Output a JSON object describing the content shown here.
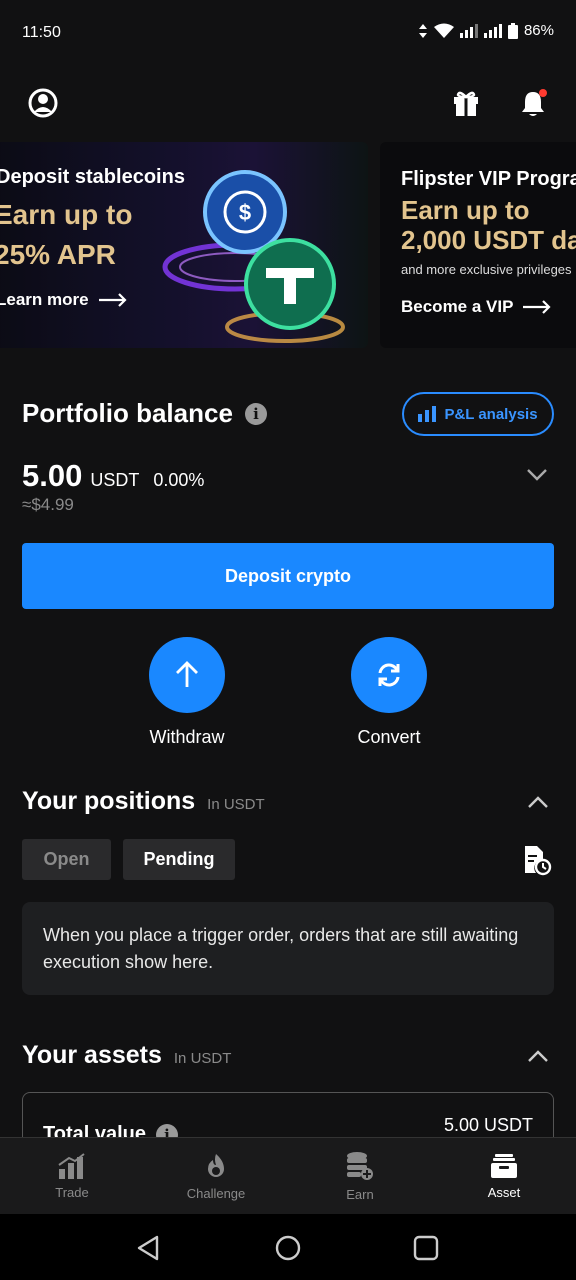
{
  "status_bar": {
    "time": "11:50",
    "battery": "86%"
  },
  "banners": [
    {
      "title": "Deposit stablecoins",
      "highlight_line1": "Earn up to",
      "highlight_line2": "25% APR",
      "link": "Learn more"
    },
    {
      "title": "Flipster VIP Progra",
      "highlight_line1": "Earn up to",
      "highlight_line2": "2,000 USDT da",
      "subtitle": "and more exclusive privileges",
      "link": "Become a VIP"
    }
  ],
  "portfolio": {
    "title": "Portfolio balance",
    "pl_button": "P&L analysis",
    "balance": "5.00",
    "unit": "USDT",
    "change": "0.00%",
    "approx": "≈$4.99",
    "deposit_button": "Deposit crypto",
    "withdraw_label": "Withdraw",
    "convert_label": "Convert"
  },
  "positions": {
    "title": "Your positions",
    "unit_label": "In USDT",
    "tabs": [
      {
        "label": "Open",
        "active": false
      },
      {
        "label": "Pending",
        "active": true
      }
    ],
    "notice": "When you place a trigger order, orders that are still awaiting execution show here."
  },
  "assets": {
    "title": "Your assets",
    "unit_label": "In USDT",
    "total_label": "Total value",
    "total_value": "5.00 USDT"
  },
  "bottom_nav": [
    {
      "label": "Trade",
      "icon": "chart-bars-icon",
      "active": false
    },
    {
      "label": "Challenge",
      "icon": "flame-icon",
      "active": false
    },
    {
      "label": "Earn",
      "icon": "coins-plus-icon",
      "active": false
    },
    {
      "label": "Asset",
      "icon": "wallet-icon",
      "active": true
    }
  ],
  "colors": {
    "accent": "#1a88ff",
    "gold": "#e2c48e",
    "background": "#111112"
  }
}
